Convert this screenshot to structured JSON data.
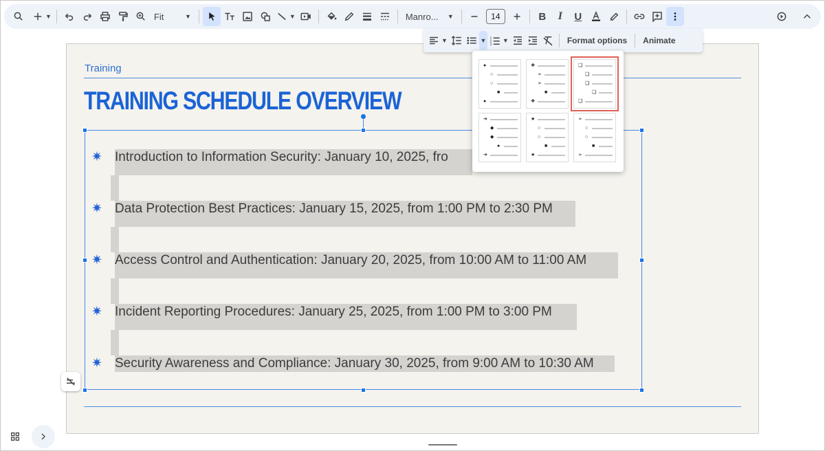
{
  "toolbar": {
    "zoom_value": "Fit",
    "font_name": "Manro...",
    "font_size": "14"
  },
  "format_bar": {
    "format_options": "Format options",
    "animate": "Animate"
  },
  "slide": {
    "topic": "Training",
    "title": "TRAINING SCHEDULE OVERVIEW",
    "bullet_symbol": "✷",
    "items": [
      "Introduction to Information Security: January 10, 2025, fro",
      "Data Protection Best Practices: January 15, 2025, from 1:00 PM to 2:30 PM",
      "Access Control and Authentication: January 20, 2025, from 10:00 AM to 11:00 AM",
      "Incident Reporting Procedures: January 25, 2025, from 1:00 PM to 3:00 PM",
      "Security Awareness and Compliance: January 30, 2025, from 9:00 AM to 10:30 AM"
    ]
  },
  "bullet_gallery": {
    "selected_index": 2,
    "presets": [
      [
        "●",
        "○",
        "○",
        "■",
        "●"
      ],
      [
        "❖",
        "➢",
        "➢",
        "■",
        "❖"
      ],
      [
        "❑",
        "❑",
        "❑",
        "❑",
        "❑"
      ],
      [
        "➔",
        "◆",
        "◆",
        "●",
        "➔"
      ],
      [
        "★",
        "○",
        "○",
        "■",
        "★"
      ],
      [
        "➢",
        "○",
        "○",
        "■",
        "➢"
      ]
    ]
  },
  "colors": {
    "accent": "#1b63d6",
    "selection": "#4a86e8",
    "highlight": "#d5d3cf",
    "slide_bg": "#f4f3ee",
    "gallery_selected_outline": "#e06055"
  },
  "icons": [
    "search-icon",
    "add-icon",
    "undo-icon",
    "redo-icon",
    "print-icon",
    "paint-format-icon",
    "zoom-icon",
    "select-cursor-icon",
    "text-box-icon",
    "image-icon",
    "shape-icon",
    "line-icon",
    "video-icon",
    "fill-color-icon",
    "border-color-icon",
    "border-weight-icon",
    "border-dash-icon",
    "text-color-icon",
    "highlight-icon",
    "link-icon",
    "comment-icon",
    "more-vert-icon",
    "present-icon",
    "collapse-icon",
    "align-left-icon",
    "line-spacing-icon",
    "bulleted-list-icon",
    "numbered-list-icon",
    "decrease-indent-icon",
    "increase-indent-icon",
    "clear-formatting-icon",
    "autofit-toggle-icon",
    "grid-view-icon",
    "chevron-right-icon"
  ]
}
